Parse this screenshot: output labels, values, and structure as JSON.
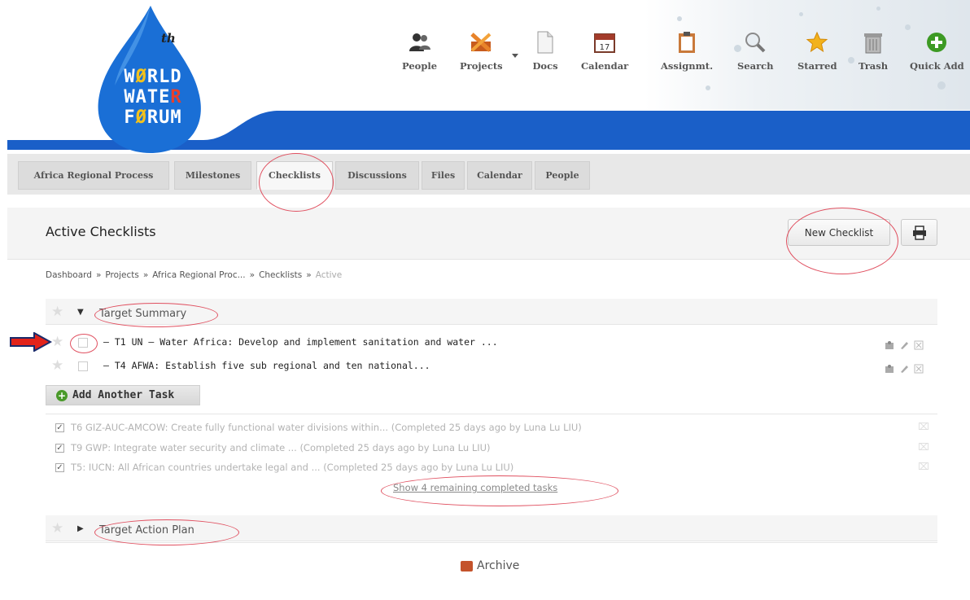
{
  "brand": {
    "logo_text": "WØRLD\nWATER\nFØRUM",
    "logo_superscript": "th",
    "primary_color": "#1a5fc8"
  },
  "nav": [
    {
      "label": "People",
      "icon": "people-icon"
    },
    {
      "label": "Projects",
      "icon": "projects-icon"
    },
    {
      "label": "Docs",
      "icon": "docs-icon"
    },
    {
      "label": "Calendar",
      "icon": "calendar-icon"
    },
    {
      "label": "Assignmt.",
      "icon": "clipboard-icon"
    },
    {
      "label": "Search",
      "icon": "search-icon"
    },
    {
      "label": "Starred",
      "icon": "star-icon"
    },
    {
      "label": "Trash",
      "icon": "trash-icon"
    },
    {
      "label": "Quick Add",
      "icon": "plus-icon"
    }
  ],
  "calendar_icon_day": "17",
  "tabs": [
    {
      "label": "Africa Regional Process"
    },
    {
      "label": "Milestones"
    },
    {
      "label": "Checklists",
      "active": true
    },
    {
      "label": "Discussions"
    },
    {
      "label": "Files"
    },
    {
      "label": "Calendar"
    },
    {
      "label": "People"
    }
  ],
  "page": {
    "title": "Active Checklists",
    "new_checklist_label": "New Checklist"
  },
  "breadcrumb": [
    "Dashboard",
    "Projects",
    "Africa Regional Proc...",
    "Checklists",
    "Active"
  ],
  "breadcrumb_separator": "»",
  "sections": [
    {
      "label": "Target Summary",
      "expanded": true
    },
    {
      "label": "Target Action Plan",
      "expanded": false
    }
  ],
  "tasks": [
    {
      "text": "– T1 UN – Water Africa: Develop and implement sanitation and water ..."
    },
    {
      "text": "– T4 AFWA: Establish five sub regional and ten national..."
    }
  ],
  "add_task_label": "Add Another Task",
  "completed": [
    {
      "text": "T6 GIZ-AUC-AMCOW: Create fully functional water divisions within...",
      "meta": "(Completed 25 days ago by Luna Lu LIU)"
    },
    {
      "text": "T9 GWP: Integrate water security and climate ...",
      "meta": "(Completed 25 days ago by Luna Lu LIU)"
    },
    {
      "text": "T5: IUCN: All African countries undertake legal and ...",
      "meta": "(Completed 25 days ago by Luna Lu LIU)"
    }
  ],
  "show_remaining_label": "Show 4 remaining completed tasks",
  "archive_label": "Archive"
}
